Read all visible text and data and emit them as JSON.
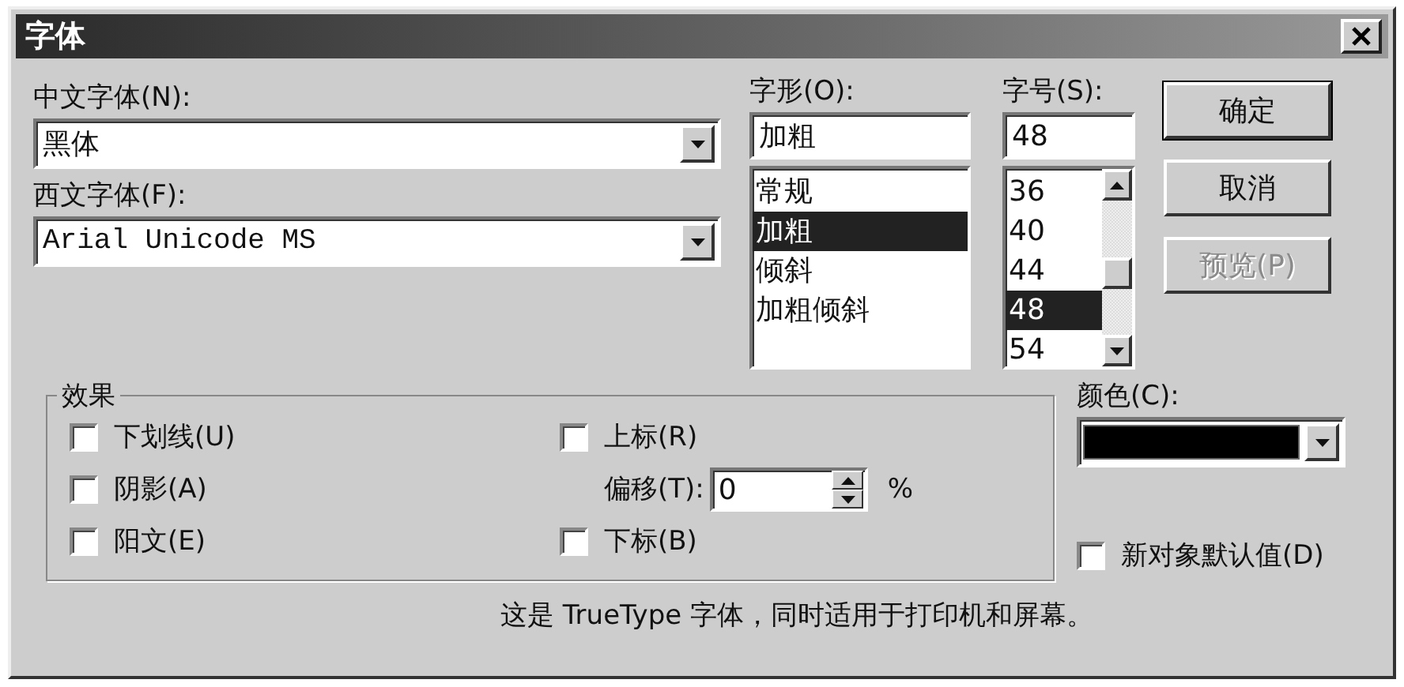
{
  "window": {
    "title": "字体"
  },
  "chinese_font": {
    "label": "中文字体(N):",
    "value": "黑体"
  },
  "western_font": {
    "label": "西文字体(F):",
    "value": "Arial Unicode MS"
  },
  "style": {
    "label": "字形(O):",
    "value": "加粗",
    "options": [
      {
        "label": "常规",
        "selected": false
      },
      {
        "label": "加粗",
        "selected": true
      },
      {
        "label": "倾斜",
        "selected": false
      },
      {
        "label": "加粗倾斜",
        "selected": false
      }
    ]
  },
  "size": {
    "label": "字号(S):",
    "value": "48",
    "options": [
      {
        "label": "36",
        "selected": false
      },
      {
        "label": "40",
        "selected": false
      },
      {
        "label": "44",
        "selected": false
      },
      {
        "label": "48",
        "selected": true
      },
      {
        "label": "54",
        "selected": false
      }
    ]
  },
  "buttons": [
    {
      "label": "确定",
      "kind": "default",
      "disabled": false
    },
    {
      "label": "取消",
      "kind": "normal",
      "disabled": false
    },
    {
      "label": "预览(P)",
      "kind": "normal",
      "disabled": true
    }
  ],
  "effects": {
    "title": "效果",
    "left_options": [
      {
        "label": "下划线(U)",
        "checked": false
      },
      {
        "label": "阴影(A)",
        "checked": false
      },
      {
        "label": "阳文(E)",
        "checked": false
      }
    ],
    "superscript": {
      "label": "上标(R)",
      "checked": false
    },
    "offset": {
      "label": "偏移(T):",
      "value": "0",
      "unit": "%"
    },
    "subscript": {
      "label": "下标(B)",
      "checked": false
    }
  },
  "color": {
    "label": "颜色(C):",
    "color": "#000000"
  },
  "default_checkbox": {
    "label": "新对象默认值(D)",
    "checked": false
  },
  "footer": "这是 TrueType 字体，同时适用于打印机和屏幕。"
}
